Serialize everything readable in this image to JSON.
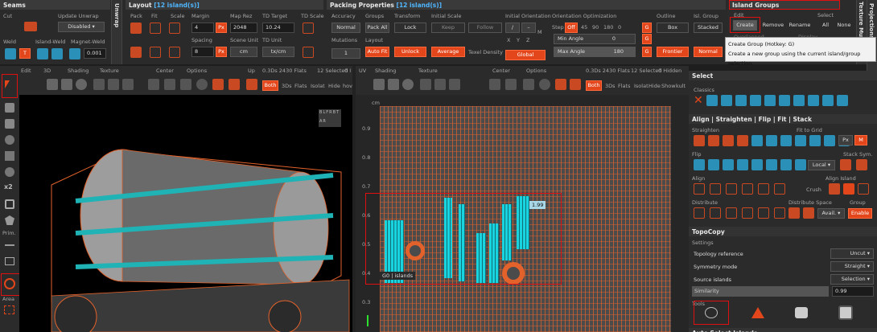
{
  "seams": {
    "title": "Seams",
    "cut": "Cut",
    "update_unwrap": "Update Unwrap",
    "disabled": "Disabled",
    "weld": "Weld",
    "island_weld": "Island-Weld",
    "magnet_weld": "Magnet-Weld",
    "magnet_value": "0.001",
    "t": "T"
  },
  "unwrap_tab": "Unwrap",
  "layout": {
    "title": "Layout",
    "islands": "[12 island(s)]",
    "pack": "Pack",
    "fit": "Fit",
    "scale": "Scale",
    "margin": "Margin",
    "margin_val": "4",
    "spacing": "Spacing",
    "spacing_val": "8",
    "px": "Px",
    "map_rez": "Map Rez",
    "map_rez_val": "2048",
    "scene_unit": "Scene Unit",
    "scene_unit_val": "cm",
    "td_target": "TD Target",
    "td_target_val": "10.24",
    "td_unit": "TD Unit",
    "td_unit_val": "tx/cm",
    "td_scale": "TD Scale"
  },
  "packing": {
    "title": "Packing Properties",
    "islands": "[12 island(s)]",
    "accuracy": "Accuracy",
    "accuracy_val": "Normal",
    "mutations": "Mutations",
    "mutations_val": "1",
    "groups": "Groups",
    "pack_all": "Pack All",
    "layout": "Layout",
    "auto_fit": "Auto Fit",
    "transform": "Transform",
    "lock": "Lock",
    "unlock": "Unlock",
    "initial_scale": "Initial Scale",
    "keep": "Keep",
    "follow": "Follow",
    "average": "Average",
    "texel_density": "Texel Density",
    "initial_orientation": "Initial Orientation",
    "x": "X",
    "y": "Y",
    "z": "Z",
    "m": "M",
    "global": "Global",
    "orientation_optimization": "Orientation Optimization",
    "step": "Step",
    "off": "Off",
    "steps": [
      "45",
      "90",
      "180",
      "0"
    ],
    "min_angle": "Min Angle",
    "min_angle_val": "0",
    "max_angle": "Max Angle",
    "max_angle_val": "180",
    "g": "G",
    "outline": "Outline",
    "box": "Box",
    "frontier": "Frontier",
    "isl_group": "Isl. Group",
    "stacked": "Stacked",
    "normal": "Normal"
  },
  "island_groups": {
    "title": "Island Groups",
    "edit": "Edit",
    "select": "Select",
    "create": "Create",
    "remove": "Remove",
    "rename": "Rename",
    "all": "All",
    "none": "None",
    "overlapped": "Overlapped",
    "display": "Display"
  },
  "tooltip": {
    "line1": "Create Group (Hotkey: G)",
    "line2": "Create a new group using the current island/group selection."
  },
  "right_tabs": {
    "texture": "Texture Mu",
    "projections": "Projections"
  },
  "vp3d": {
    "edit": "Edit",
    "3d": "3D",
    "shading": "Shading",
    "texture": "Texture",
    "center": "Center",
    "options": "Options",
    "up": "Up",
    "stats": "0.3Ds 2430 Flats",
    "selected": "12 Selected",
    "hidden": "0 I",
    "both": "Both",
    "3ds": "3Ds",
    "flats": "Flats",
    "isolate": "Isolat",
    "hide": "Hide",
    "hov": "hov",
    "prim": "Prim.",
    "area": "Area",
    "x2": "x2",
    "gizmo": [
      "B",
      "L",
      "F",
      "R",
      "B",
      "T",
      "A",
      "R"
    ]
  },
  "vpuv": {
    "uv": "UV",
    "shading": "Shading",
    "texture": "Texture",
    "center": "Center",
    "options": "Options",
    "stats": "0.3Ds 2430 Flats",
    "selected": "12 Selected",
    "hidden": "0 Hidden",
    "both": "Both",
    "3ds": "3Ds",
    "flats": "Flats",
    "isolate": "Isolat",
    "hide": "Hide",
    "show": "Show",
    "kult": "kult",
    "cm": "cm",
    "yticks": [
      "0.9",
      "0.8",
      "0.7",
      "0.6",
      "0.5",
      "0.4",
      "0.3"
    ],
    "group_label": "G0 | islands",
    "td_badge": "1.99"
  },
  "right": {
    "select_title": "Select",
    "classics": "Classics",
    "align_title": "Align | Straighten | Flip | Fit | Stack",
    "straighten": "Straighten",
    "fit_to_grid": "Fit to Grid",
    "flip": "Flip",
    "stack_sym": "Stack Sym.",
    "local": "Local",
    "align": "Align",
    "align_island": "Align Island",
    "crush": "Crush",
    "distribute": "Distribute",
    "distribute_space": "Distribute Space",
    "avail": "Avail.",
    "group": "Group",
    "enable": "Enable",
    "px": "Px",
    "m": "M",
    "topocopy_title": "TopoCopy",
    "settings": "Settings",
    "topology_reference": "Topology reference",
    "topology_reference_val": "Uncut",
    "symmetry_mode": "Symmetry mode",
    "symmetry_mode_val": "Straight",
    "source_islands": "Source islands",
    "source_islands_val": "Selection",
    "similarity": "Similarity",
    "similarity_val": "0.99",
    "tools": "Tools",
    "auto_select": "Auto Select Islands"
  },
  "colors": {
    "accent": "#e3461b",
    "selected_uv": "#19d3df",
    "red_highlight": "#e01010"
  }
}
